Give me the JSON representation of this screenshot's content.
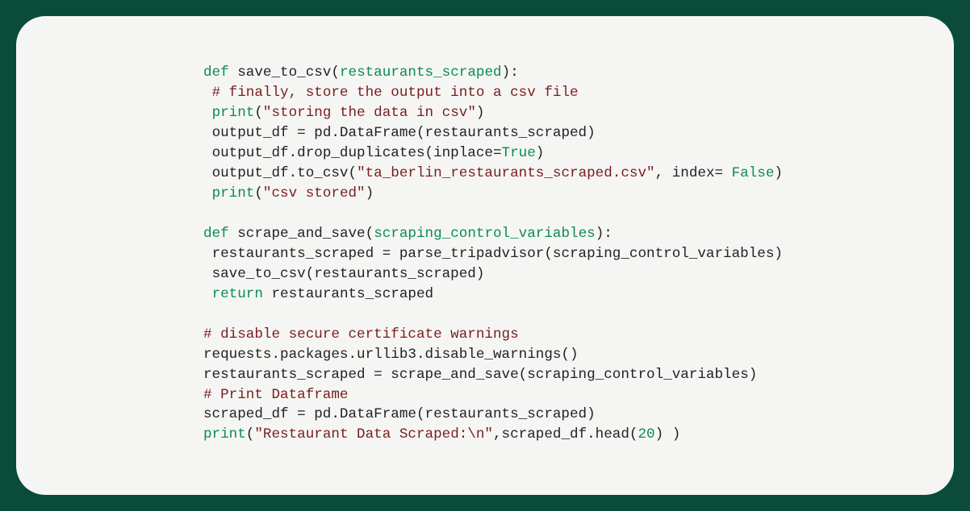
{
  "code": {
    "l1_def": "def",
    "l1_fname": "save_to_csv",
    "l1_arg": "restaurants_scraped",
    "l2_cmt": "# finally, store the output into a csv file",
    "l3_print": "print",
    "l3_str": "\"storing the data in csv\"",
    "l4": "output_df = pd.DataFrame(restaurants_scraped)",
    "l5_a": "output_df.drop_duplicates(inplace=",
    "l5_true": "True",
    "l5_b": ")",
    "l6_a": "output_df.to_csv(",
    "l6_str": "\"ta_berlin_restaurants_scraped.csv\"",
    "l6_b": ", index= ",
    "l6_false": "False",
    "l6_c": ")",
    "l7_print": "print",
    "l7_str": "\"csv stored\"",
    "l9_def": "def",
    "l9_fname": "scrape_and_save",
    "l9_arg": "scraping_control_variables",
    "l10": "restaurants_scraped = parse_tripadvisor(scraping_control_variables)",
    "l11": "save_to_csv(restaurants_scraped)",
    "l12_ret": "return",
    "l12_b": " restaurants_scraped",
    "l14_cmt": "# disable secure certificate warnings",
    "l15": "requests.packages.urllib3.disable_warnings()",
    "l16": "restaurants_scraped = scrape_and_save(scraping_control_variables)",
    "l17_cmt": "# Print Dataframe",
    "l18": "scraped_df = pd.DataFrame(restaurants_scraped)",
    "l19_print": "print",
    "l19_str": "\"Restaurant Data Scraped:\\n\"",
    "l19_b": ",scraped_df.head(",
    "l19_num": "20",
    "l19_c": ") )"
  }
}
